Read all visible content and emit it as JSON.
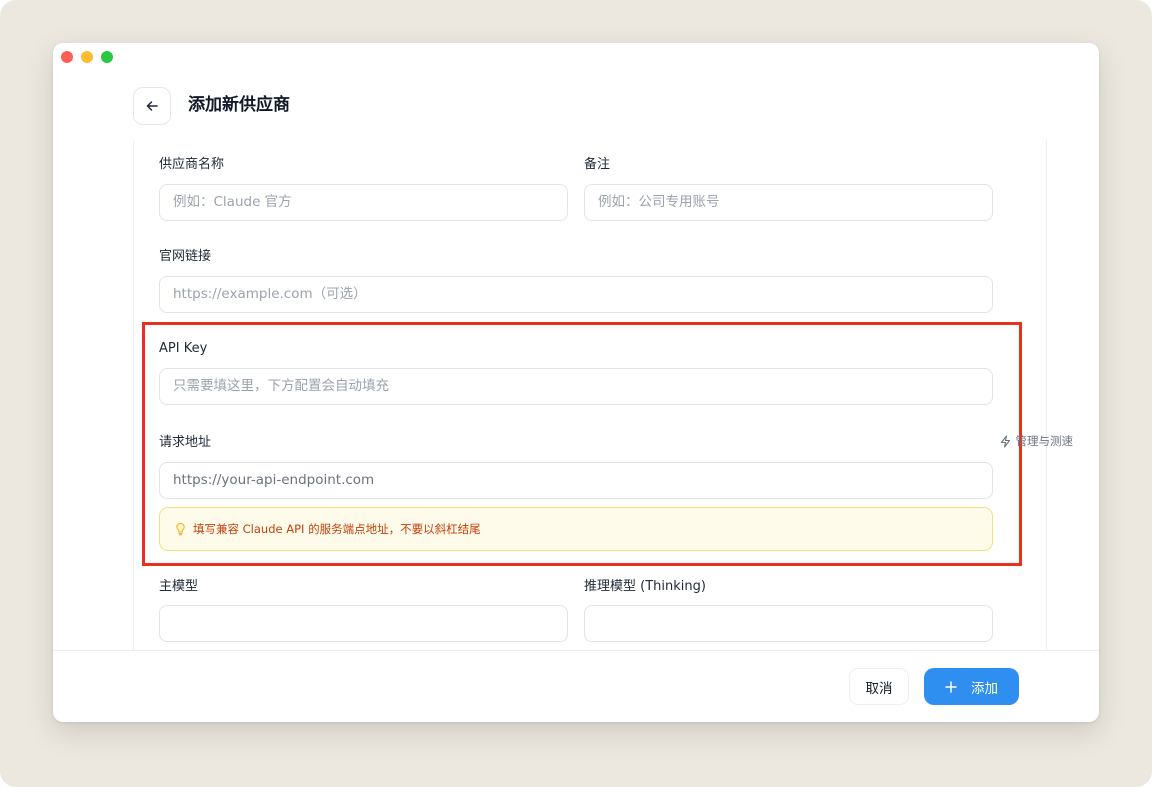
{
  "window": {
    "title": "添加新供应商"
  },
  "form": {
    "provider_name": {
      "label": "供应商名称",
      "placeholder": "例如：Claude 官方"
    },
    "note": {
      "label": "备注",
      "placeholder": "例如：公司专用账号"
    },
    "website": {
      "label": "官网链接",
      "placeholder": "https://example.com（可选）"
    },
    "api_key": {
      "label": "API Key",
      "placeholder": "只需要填这里，下方配置会自动填充"
    },
    "endpoint": {
      "label": "请求地址",
      "manage_link": "管理与测速",
      "placeholder": "https://your-api-endpoint.com",
      "tip": "填写兼容 Claude API 的服务端点地址，不要以斜杠结尾"
    },
    "main_model": {
      "label": "主模型",
      "value": ""
    },
    "thinking_model": {
      "label": "推理模型 (Thinking)",
      "value": ""
    }
  },
  "footer": {
    "cancel_label": "取消",
    "add_label": "添加"
  },
  "icons": {
    "back": "arrow-left-icon",
    "manage": "lightning-icon",
    "tip": "lightbulb-icon",
    "add": "plus-icon"
  },
  "colors": {
    "accent": "#2e8ff0",
    "highlight_border": "#e8301c",
    "tip_bg": "#fffbea",
    "tip_text": "#c2410c"
  }
}
